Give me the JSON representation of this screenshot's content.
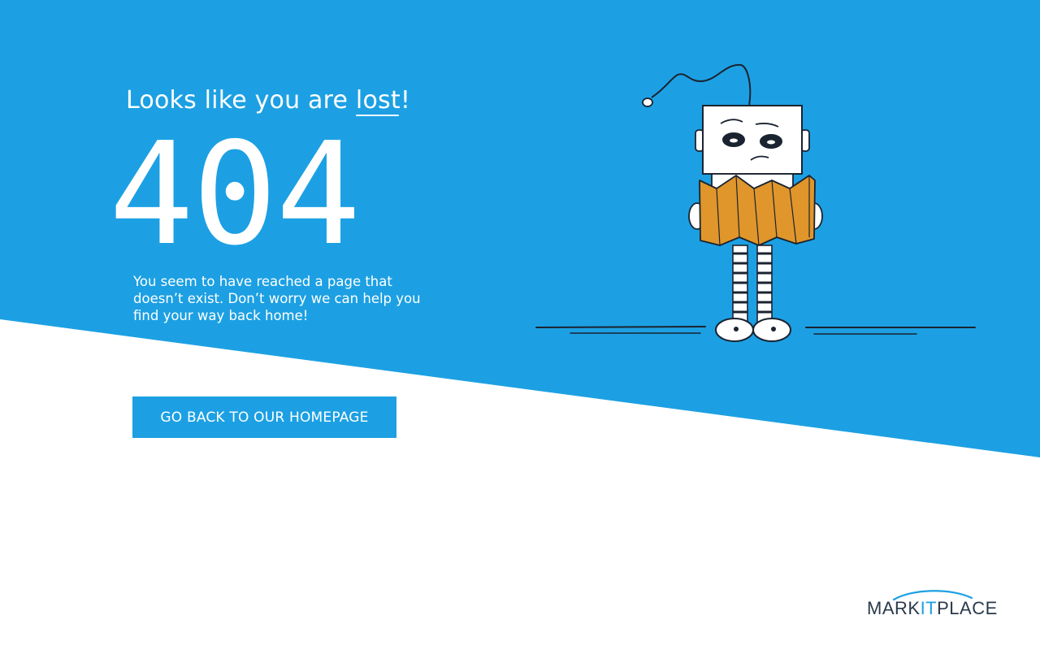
{
  "colors": {
    "primary_blue": "#1ca0e3",
    "background_white": "#ffffff",
    "map_orange": "#e0962a",
    "logo_dark": "#2a3a4a"
  },
  "hero": {
    "headline_prefix": "Looks like you are ",
    "headline_emphasis": "lost",
    "headline_suffix": "!",
    "error_code": "404",
    "message": "You seem to have reached a page that doesn’t exist. Don’t worry we can help you find your way back home!"
  },
  "cta": {
    "home_button_label": "GO BACK TO OUR HOMEPAGE"
  },
  "illustration": {
    "icon": "lost-robot-holding-map-icon"
  },
  "brand": {
    "logo_part1": "MARK",
    "logo_accent": "IT",
    "logo_part2": "PLACE"
  }
}
